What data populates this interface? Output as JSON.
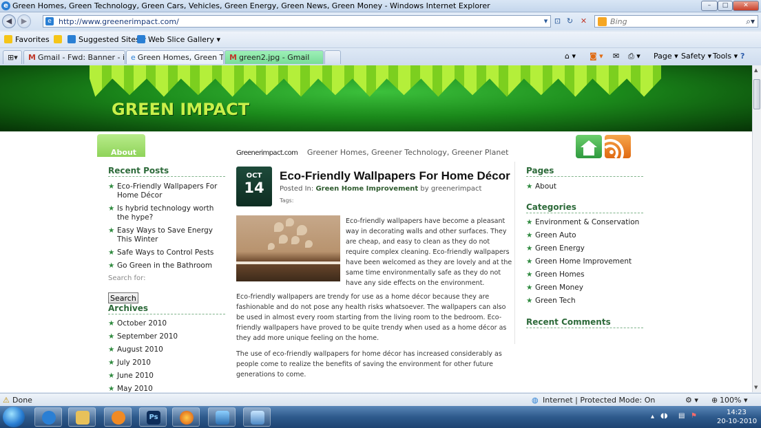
{
  "window": {
    "title": "Green Homes, Green Technology, Green Cars, Vehicles, Green Energy, Green News, Green Money - Windows Internet Explorer",
    "minimize": "–",
    "maximize": "□",
    "close": "✕"
  },
  "addressbar": {
    "url": "http://www.greenerimpact.com/",
    "search_placeholder": "Bing"
  },
  "favorites_bar": {
    "favorites": "Favorites",
    "suggested_sites": "Suggested Sites ▾",
    "web_slice_gallery": "Web Slice Gallery ▾"
  },
  "tabs": [
    {
      "label": "Gmail - Fwd: Banner - ila.v..."
    },
    {
      "label": "Green Homes, Green T...",
      "close": "✕"
    },
    {
      "label": "green2.jpg - Gmail"
    }
  ],
  "command_bar": {
    "page": "Page ▾",
    "safety": "Safety ▾",
    "tools": "Tools ▾",
    "help": "?"
  },
  "site": {
    "logo": "GREEN IMPACT",
    "about_tab": "About",
    "brand": "Greenerimpact.com",
    "tagline": "Greener Homes, Greener Technology, Greener Planet"
  },
  "left_sidebar": {
    "recent_posts_heading": "Recent Posts",
    "recent_posts": [
      "Eco-Friendly Wallpapers For Home Décor",
      "Is hybrid technology worth the hype?",
      "Easy Ways to Save Energy This Winter",
      "Safe Ways to Control Pests",
      "Go Green in the Bathroom"
    ],
    "search_label": "Search for:",
    "search_button": "Search",
    "archives_heading": "Archives",
    "archives": [
      "October 2010",
      "September 2010",
      "August 2010",
      "July 2010",
      "June 2010",
      "May 2010"
    ]
  },
  "post": {
    "month": "OCT",
    "day": "14",
    "title": "Eco-Friendly Wallpapers For Home Décor",
    "posted_in_label": "Posted In:",
    "category": "Green Home Improvement",
    "by_label": "by",
    "author": "greenerimpact",
    "tags_label": "Tags:",
    "para1": "Eco-friendly wallpapers have become a pleasant way in decorating walls and other surfaces. They are cheap, and easy to clean as they do not require complex cleaning. Eco-friendly wallpapers have been welcomed as they are lovely and at the same time environmentally safe as they do not have any side effects on the environment.",
    "para2": "Eco-friendly wallpapers are trendy for use as a home décor because they are fashionable and do not pose any health risks whatsoever. The wallpapers can also be used in almost every room starting from the living room to the bedroom. Eco-friendly wallpapers have proved to be quite trendy when used as a home décor as they add more unique feeling on the home.",
    "para3": "The use of eco-friendly wallpapers for home décor has increased considerably as people come to realize the benefits of saving the environment for other future generations to come."
  },
  "right_sidebar": {
    "pages_heading": "Pages",
    "pages": [
      "About"
    ],
    "categories_heading": "Categories",
    "categories": [
      "Environment & Conservation",
      "Green Auto",
      "Green Energy",
      "Green Home Improvement",
      "Green Homes",
      "Green Money",
      "Green Tech"
    ],
    "recent_comments_heading": "Recent Comments"
  },
  "statusbar": {
    "status": "Done",
    "zone": "Internet | Protected Mode: On",
    "zoom": "100%"
  },
  "taskbar": {
    "time": "14:23",
    "date": "20-10-2010"
  },
  "colors": {
    "accent_green": "#2d6a3a",
    "banner_green": "#1b8a1b",
    "about_tab": "#8fd35a"
  }
}
